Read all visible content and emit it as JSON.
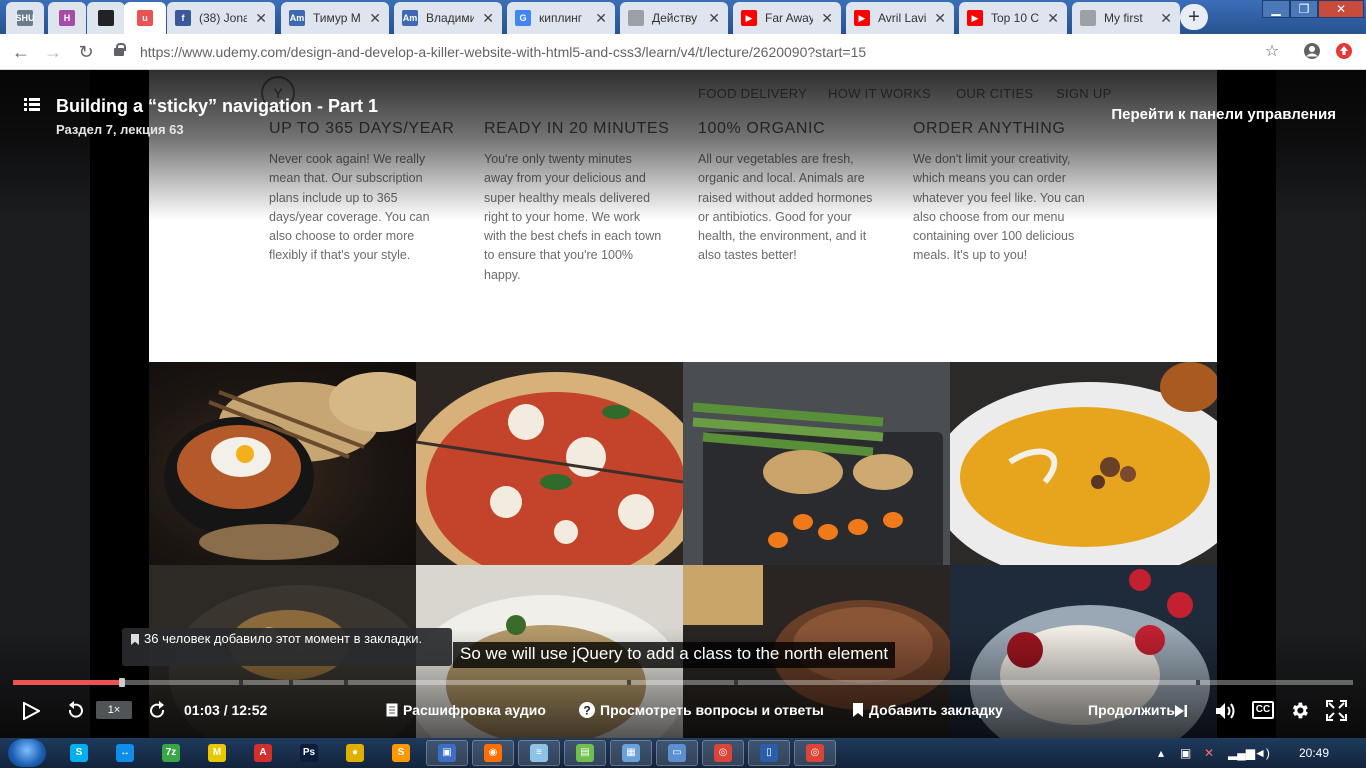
{
  "browser": {
    "tabs": [
      {
        "title": "",
        "favicon": "shu-blog-icon",
        "fav_text": "SHU",
        "color": "#6a7b8c"
      },
      {
        "title": "",
        "favicon": "h-icon",
        "fav_text": "H",
        "color": "#a64ca6"
      },
      {
        "title": "",
        "favicon": "github-icon",
        "fav_text": "",
        "color": "#222222"
      },
      {
        "title": "",
        "favicon": "udemy-icon",
        "fav_text": "u",
        "color": "#ec5252",
        "active": true
      },
      {
        "title": "(38) Jona",
        "favicon": "facebook-icon",
        "fav_text": "f",
        "color": "#3b5998"
      },
      {
        "title": "Тимур М",
        "favicon": "am-icon",
        "fav_text": "Am",
        "color": "#3d6ab4"
      },
      {
        "title": "Владими",
        "favicon": "am-icon",
        "fav_text": "Am",
        "color": "#3d6ab4"
      },
      {
        "title": "киплинг",
        "favicon": "google-icon",
        "fav_text": "G",
        "color": "#4285f4"
      },
      {
        "title": "Действу",
        "favicon": "document-icon",
        "fav_text": "",
        "color": "#9aa0a6"
      },
      {
        "title": "Far Away",
        "favicon": "youtube-icon",
        "fav_text": "▶",
        "color": "#ff0000"
      },
      {
        "title": "Avril Lavi",
        "favicon": "youtube-icon",
        "fav_text": "▶",
        "color": "#ff0000"
      },
      {
        "title": "Top 10 C",
        "favicon": "youtube-icon",
        "fav_text": "▶",
        "color": "#ff0000"
      },
      {
        "title": "My first ",
        "favicon": "document-icon",
        "fav_text": "",
        "color": "#9aa0a6"
      }
    ],
    "new_tab": "+",
    "url": "https://www.udemy.com/design-and-develop-a-killer-website-with-html5-and-css3/learn/v4/t/lecture/2620090?start=15"
  },
  "header": {
    "course_title": "Building a “sticky” navigation - Part 1",
    "section_info": "Раздел 7, лекция 63",
    "dashboard_link": "Перейти к панели управления"
  },
  "site": {
    "nav": [
      "FOOD DELIVERY",
      "HOW IT WORKS",
      "OUR CITIES",
      "SIGN UP"
    ],
    "features": [
      {
        "title": "UP TO 365 DAYS/YEAR",
        "text": "Never cook again! We really mean that. Our subscription plans include up to 365 days/year coverage. You can also choose to order more flexibly if that's your style."
      },
      {
        "title": "READY IN 20 MINUTES",
        "text": "You're only twenty minutes away from your delicious and super healthy meals delivered right to your home. We work with the best chefs in each town to ensure that you're 100% happy."
      },
      {
        "title": "100% ORGANIC",
        "text": "All our vegetables are fresh, organic and local. Animals are raised without added hormones or antibiotics. Good for your health, the environment, and it also tastes better!"
      },
      {
        "title": "ORDER ANYTHING",
        "text": "We don't limit your creativity, which means you can order whatever you feel like. You can also choose from our menu containing over 100 delicious meals. It's up to you!"
      }
    ]
  },
  "player": {
    "bookmark_note": "36 человек добавило этот момент в закладки.",
    "caption": "So we will use jQuery to add a class to the north element",
    "progress_fraction": 0.082,
    "speed": "1×",
    "time": "01:03 / 12:52",
    "transcript_label": "Расшифровка аудио",
    "qa_label": "Просмотреть вопросы и ответы",
    "bookmark_label": "Добавить закладку",
    "continue_label": "Продолжить",
    "cc_label": "CC"
  },
  "taskbar": {
    "clock": "20:49",
    "apps": [
      {
        "name": "skype",
        "color": "#00aff0",
        "glyph": "S"
      },
      {
        "name": "teamviewer",
        "color": "#0e8ee9",
        "glyph": "↔"
      },
      {
        "name": "cheat-app",
        "color": "#3aa648",
        "glyph": "7z"
      },
      {
        "name": "mail",
        "color": "#e8c800",
        "glyph": "M"
      },
      {
        "name": "pdf",
        "color": "#d32f2f",
        "glyph": "A"
      },
      {
        "name": "photoshop",
        "color": "#0a1d3a",
        "glyph": "Ps"
      },
      {
        "name": "color-app",
        "color": "#e0b000",
        "glyph": "●"
      },
      {
        "name": "sublime",
        "color": "#ff9800",
        "glyph": "S"
      },
      {
        "name": "floppy",
        "color": "#3c6fc4",
        "glyph": "▣"
      },
      {
        "name": "firefox",
        "color": "#ff6f00",
        "glyph": "◉"
      },
      {
        "name": "notepad",
        "color": "#8ec3e8",
        "glyph": "≡"
      },
      {
        "name": "explorer",
        "color": "#6fbf4f",
        "glyph": "▤"
      },
      {
        "name": "network",
        "color": "#6aa1d8",
        "glyph": "▦"
      },
      {
        "name": "window",
        "color": "#5b8fd0",
        "glyph": "▭"
      },
      {
        "name": "chrome",
        "color": "#db4437",
        "glyph": "◎"
      },
      {
        "name": "ide",
        "color": "#2a5ea8",
        "glyph": "▯"
      },
      {
        "name": "chrome2",
        "color": "#db4437",
        "glyph": "◎"
      }
    ]
  }
}
